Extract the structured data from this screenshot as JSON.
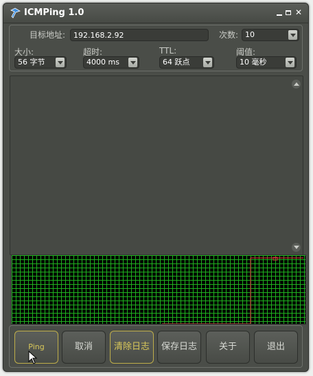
{
  "window": {
    "title": "ICMPing 1.0"
  },
  "settings": {
    "target_label": "目标地址:",
    "target_value": "192.168.2.92",
    "count_label": "次数:",
    "count_value": "10",
    "size_label": "大小:",
    "size_value": "56 字节",
    "timeout_label": "超时:",
    "timeout_value": "4000 ms",
    "ttl_label": "TTL:",
    "ttl_value": "64 跃点",
    "threshold_label": "阈值:",
    "threshold_value": "10 毫秒"
  },
  "buttons": {
    "ping": "Ping",
    "cancel": "取消",
    "clear_log": "清除日志",
    "save_log": "保存日志",
    "about": "关于",
    "exit": "退出"
  },
  "colors": {
    "grid": "#1fb21f",
    "threshold_line": "#c8323a",
    "highlight_button": "#d9c85a"
  },
  "icons": [
    "app-icon",
    "minimize-icon",
    "maximize-icon",
    "close-icon",
    "dropdown-arrow-icon",
    "scroll-up-icon",
    "scroll-down-icon",
    "mouse-cursor-icon"
  ]
}
